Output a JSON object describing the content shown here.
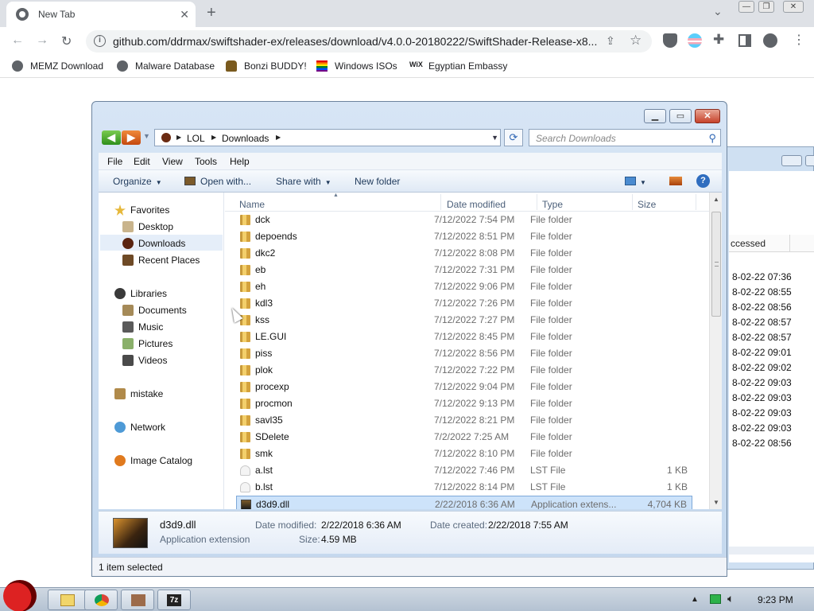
{
  "browser": {
    "tab_title": "New Tab",
    "url": "github.com/ddrmax/swiftshader-ex/releases/download/v4.0.0-20180222/SwiftShader-Release-x8...",
    "bookmarks": [
      "MEMZ Download",
      "Malware Database",
      "Bonzi BUDDY!",
      "Windows ISOs",
      "Egyptian Embassy"
    ]
  },
  "explorer": {
    "breadcrumb": [
      "LOL",
      "Downloads"
    ],
    "search_placeholder": "Search Downloads",
    "menu": [
      "File",
      "Edit",
      "View",
      "Tools",
      "Help"
    ],
    "commands": {
      "organize": "Organize",
      "open_with": "Open with...",
      "share_with": "Share with",
      "new_folder": "New folder"
    },
    "nav": {
      "favorites": "Favorites",
      "desktop": "Desktop",
      "downloads": "Downloads",
      "recent": "Recent Places",
      "libraries": "Libraries",
      "documents": "Documents",
      "music": "Music",
      "pictures": "Pictures",
      "videos": "Videos",
      "user": "mistake",
      "network": "Network",
      "image_catalog": "Image Catalog"
    },
    "columns": {
      "name": "Name",
      "date": "Date modified",
      "type": "Type",
      "size": "Size"
    },
    "files": [
      {
        "name": "dck",
        "date": "7/12/2022 7:54 PM",
        "type": "File folder",
        "size": "",
        "icon": "folder"
      },
      {
        "name": "depoends",
        "date": "7/12/2022 8:51 PM",
        "type": "File folder",
        "size": "",
        "icon": "folder"
      },
      {
        "name": "dkc2",
        "date": "7/12/2022 8:08 PM",
        "type": "File folder",
        "size": "",
        "icon": "folder"
      },
      {
        "name": "eb",
        "date": "7/12/2022 7:31 PM",
        "type": "File folder",
        "size": "",
        "icon": "folder"
      },
      {
        "name": "eh",
        "date": "7/12/2022 9:06 PM",
        "type": "File folder",
        "size": "",
        "icon": "folder"
      },
      {
        "name": "kdl3",
        "date": "7/12/2022 7:26 PM",
        "type": "File folder",
        "size": "",
        "icon": "folder"
      },
      {
        "name": "kss",
        "date": "7/12/2022 7:27 PM",
        "type": "File folder",
        "size": "",
        "icon": "folder"
      },
      {
        "name": "LE.GUI",
        "date": "7/12/2022 8:45 PM",
        "type": "File folder",
        "size": "",
        "icon": "folder"
      },
      {
        "name": "piss",
        "date": "7/12/2022 8:56 PM",
        "type": "File folder",
        "size": "",
        "icon": "folder"
      },
      {
        "name": "plok",
        "date": "7/12/2022 7:22 PM",
        "type": "File folder",
        "size": "",
        "icon": "folder"
      },
      {
        "name": "procexp",
        "date": "7/12/2022 9:04 PM",
        "type": "File folder",
        "size": "",
        "icon": "folder"
      },
      {
        "name": "procmon",
        "date": "7/12/2022 9:13 PM",
        "type": "File folder",
        "size": "",
        "icon": "folder"
      },
      {
        "name": "savl35",
        "date": "7/12/2022 8:21 PM",
        "type": "File folder",
        "size": "",
        "icon": "folder"
      },
      {
        "name": "SDelete",
        "date": "7/2/2022 7:25 AM",
        "type": "File folder",
        "size": "",
        "icon": "folder"
      },
      {
        "name": "smk",
        "date": "7/12/2022 8:10 PM",
        "type": "File folder",
        "size": "",
        "icon": "folder"
      },
      {
        "name": "a.lst",
        "date": "7/12/2022 7:46 PM",
        "type": "LST File",
        "size": "1 KB",
        "icon": "lst"
      },
      {
        "name": "b.lst",
        "date": "7/12/2022 8:14 PM",
        "type": "LST File",
        "size": "1 KB",
        "icon": "lst"
      },
      {
        "name": "d3d9.dll",
        "date": "2/22/2018 6:36 AM",
        "type": "Application extens...",
        "size": "4,704 KB",
        "icon": "dll",
        "selected": true
      }
    ],
    "details": {
      "name": "d3d9.dll",
      "type": "Application extension",
      "modified_label": "Date modified:",
      "modified": "2/22/2018 6:36 AM",
      "created_label": "Date created:",
      "created": "2/22/2018 7:55 AM",
      "size_label": "Size:",
      "size": "4.59 MB"
    },
    "status": "1 item selected"
  },
  "background_window": {
    "column_header": "ccessed",
    "rows": [
      "8-02-22 07:36",
      "8-02-22 08:55",
      "8-02-22 08:56",
      "8-02-22 08:57",
      "8-02-22 08:57",
      "8-02-22 09:01",
      "8-02-22 09:02",
      "8-02-22 09:03",
      "8-02-22 09:03",
      "8-02-22 09:03",
      "8-02-22 09:03",
      "8-02-22 08:56"
    ]
  },
  "taskbar": {
    "clock": "9:23 PM"
  }
}
